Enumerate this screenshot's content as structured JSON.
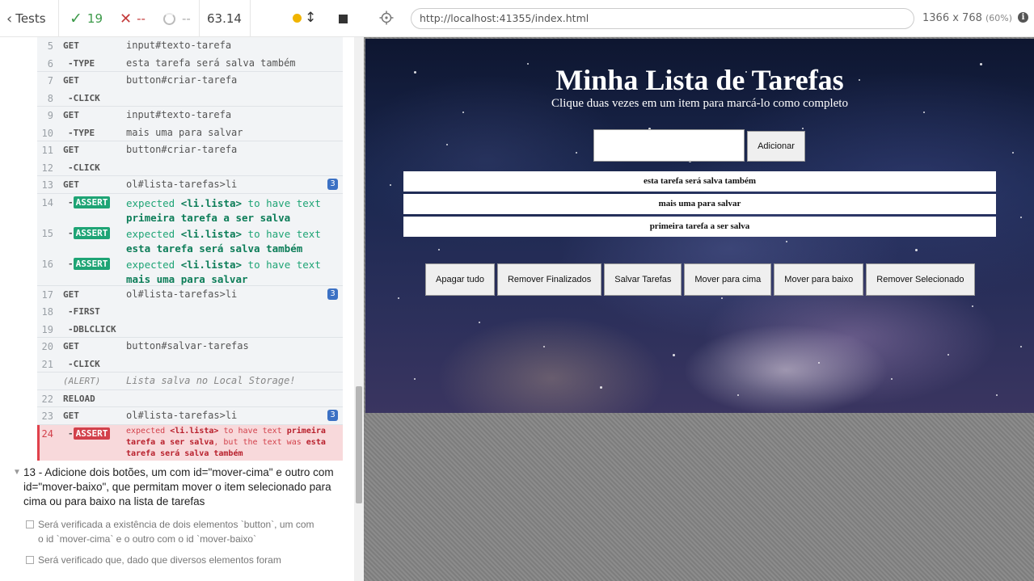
{
  "reporter": {
    "tests_label": "Tests",
    "passed": "19",
    "failed": "--",
    "pending": "--",
    "duration": "63.14"
  },
  "commands": [
    {
      "num": "5",
      "name": "GET",
      "msg": "input#texto-tarefa",
      "child": false
    },
    {
      "num": "6",
      "name": "-TYPE",
      "msg": "esta tarefa será salva também",
      "child": true
    },
    {
      "num": "7",
      "name": "GET",
      "msg": "button#criar-tarefa",
      "child": false
    },
    {
      "num": "8",
      "name": "-CLICK",
      "msg": "",
      "child": true
    },
    {
      "num": "9",
      "name": "GET",
      "msg": "input#texto-tarefa",
      "child": false
    },
    {
      "num": "10",
      "name": "-TYPE",
      "msg": "mais uma para salvar",
      "child": true
    },
    {
      "num": "11",
      "name": "GET",
      "msg": "button#criar-tarefa",
      "child": false
    },
    {
      "num": "12",
      "name": "-CLICK",
      "msg": "",
      "child": true
    },
    {
      "num": "13",
      "name": "GET",
      "msg": "ol#lista-tarefas>li",
      "badge": "3",
      "child": false
    }
  ],
  "asserts": [
    {
      "num": "14",
      "tag": "ASSERT",
      "pre": "expected",
      "el": "<li.lista>",
      "mid": "to have text",
      "text": "primeira tarefa a ser salva"
    },
    {
      "num": "15",
      "tag": "ASSERT",
      "pre": "expected",
      "el": "<li.lista>",
      "mid": "to have text",
      "text": "esta tarefa será salva também"
    },
    {
      "num": "16",
      "tag": "ASSERT",
      "pre": "expected",
      "el": "<li.lista>",
      "mid": "to have text",
      "text": "mais uma para salvar"
    }
  ],
  "commands2": [
    {
      "num": "17",
      "name": "GET",
      "msg": "ol#lista-tarefas>li",
      "badge": "3",
      "child": false
    },
    {
      "num": "18",
      "name": "-FIRST",
      "msg": "",
      "child": true
    },
    {
      "num": "19",
      "name": "-DBLCLICK",
      "msg": "",
      "child": true
    },
    {
      "num": "20",
      "name": "GET",
      "msg": "button#salvar-tarefas",
      "child": false
    },
    {
      "num": "21",
      "name": "-CLICK",
      "msg": "",
      "child": true
    },
    {
      "num": "",
      "name": "(ALERT)",
      "msg": "Lista salva no Local Storage!",
      "child": false
    },
    {
      "num": "22",
      "name": "RELOAD",
      "msg": "",
      "child": false
    },
    {
      "num": "23",
      "name": "GET",
      "msg": "ol#lista-tarefas>li",
      "badge": "3",
      "child": false
    }
  ],
  "failed_assert": {
    "num": "24",
    "tag": "ASSERT",
    "pre": "expected",
    "el": "<li.lista>",
    "mid": "to have text",
    "expected": "primeira tarefa a ser salva",
    "post": ", but the text was",
    "actual": "esta tarefa será salva também"
  },
  "test13": {
    "title": "13 - Adicione dois botões, um com id=\"mover-cima\" e outro com id=\"mover-baixo\", que permitam mover o item selecionado para cima ou para baixo na lista de tarefas",
    "sub1": "Será verificada a existência de dois elementos `button`, um com o id `mover-cima` e o outro com o id `mover-baixo`",
    "sub2": "Será verificado que, dado que diversos elementos foram"
  },
  "browser": {
    "url": "http://localhost:41355/index.html",
    "size": "1366 x 768",
    "scale": "(60%)"
  },
  "app": {
    "title": "Minha Lista de Tarefas",
    "subtitle": "Clique duas vezes em um item para marcá-lo como completo",
    "add_label": "Adicionar",
    "tasks": [
      "esta tarefa será salva também",
      "mais uma para salvar",
      "primeira tarefa a ser salva"
    ],
    "buttons": [
      "Apagar tudo",
      "Remover Finalizados",
      "Salvar Tarefas",
      "Mover para cima",
      "Mover para baixo",
      "Remover Selecionado"
    ]
  }
}
